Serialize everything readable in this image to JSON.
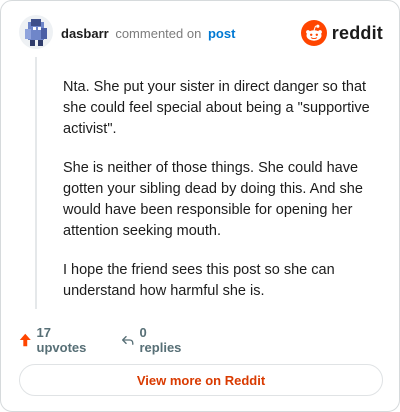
{
  "header": {
    "username": "dasbarr",
    "action": "commented on",
    "post_link": "post",
    "logo_text": "reddit"
  },
  "comment": {
    "paragraphs": [
      "Nta. She put your sister in direct danger so that she could feel special about being a \"supportive activist\".",
      "She is neither of those things. She could have gotten your sibling dead by doing this. And she would have been responsible for opening her attention seeking mouth.",
      "I hope the friend sees this post so she can understand how harmful she is."
    ]
  },
  "footer": {
    "upvotes": "17 upvotes",
    "replies": "0 replies"
  },
  "view_more_label": "View more on Reddit",
  "colors": {
    "brand": "#ff4500",
    "link": "#0079d3",
    "view_more": "#d93a00",
    "upvote_arrow": "#ff4500"
  },
  "icons": {
    "avatar": "user-avatar",
    "logo": "reddit-snoo-icon",
    "upvote": "upvote-arrow-icon",
    "reply": "reply-arrow-icon"
  }
}
